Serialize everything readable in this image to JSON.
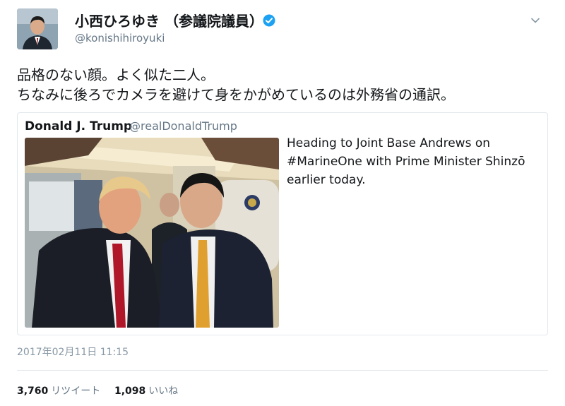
{
  "author": {
    "name": "小西ひろゆき （参議院議員）",
    "screen_name": "@konishihiroyuki",
    "verified_icon": "verified-badge-icon",
    "verified_color": "#1da1f2"
  },
  "tweet": {
    "lines": [
      "品格のない顔。よく似た二人。",
      "ちなみに後ろでカメラを避けて身をかがめているのは外務省の通訳。"
    ],
    "timestamp": "2017年02月11日 11:15"
  },
  "quoted_tweet": {
    "author_name": "Donald J. Trump",
    "author_handle": "@realDonaldTrump",
    "text_lines": [
      "Heading to Joint Base Andrews on",
      "#MarineOne with Prime Minister Shinzō",
      "earlier today."
    ]
  },
  "stats": {
    "retweets_count": "3,760",
    "retweets_label": "リツイート",
    "likes_count": "1,098",
    "likes_label": "いいね"
  },
  "icons": {
    "menu": "chevron-down-icon",
    "avatar": "avatar"
  },
  "colors": {
    "text": "#14171a",
    "secondary": "#657786",
    "border": "#e1e8ed",
    "link_blue": "#1da1f2"
  }
}
